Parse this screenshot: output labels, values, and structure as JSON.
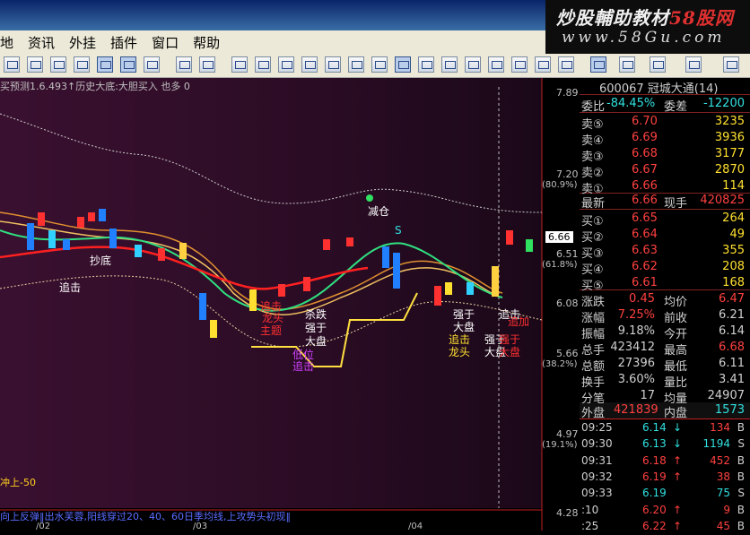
{
  "window": {
    "brand_line1": "炒股輔助教材",
    "brand_line1_red": "58股网",
    "brand_line2": "www.58Gu.com"
  },
  "menu": [
    "地",
    "资讯",
    "外挂",
    "插件",
    "窗口",
    "帮助"
  ],
  "chart": {
    "info_line": "买预测1.6.493↑历史大底:大胆买入 也多 0",
    "price_ticks": [
      "7.89",
      "7.20",
      "6.51",
      "6.08",
      "5.66",
      "4.97",
      "4.28"
    ],
    "pct_ticks": [
      "(80.9%)",
      "(61.8%)",
      "(38.2%)",
      "(19.1%)"
    ],
    "current_price_tag": "6.66",
    "bottom_text": "向上反弹‖出水芙蓉,阳线穿过20、40、60日季均线,上攻势头初现‖",
    "left_note": "冲上-50",
    "x_labels": [
      "/02",
      "/03",
      "/04"
    ],
    "annotations": [
      "追击",
      "减仓",
      "S",
      "追击",
      "龙头",
      "主题",
      "杀跌",
      "强于",
      "大盘",
      "低位",
      "追击",
      "抄底",
      "强于",
      "大盘",
      "追击",
      "龙头",
      "强于",
      "大盘",
      "追击",
      "追加",
      "强于",
      "大盘"
    ]
  },
  "quote": {
    "title": "600067 冠城大通(14)",
    "weibi_label": "委比",
    "weibi_value": "-84.45%",
    "weicha_label": "委差",
    "weicha_value": "-12200",
    "sells": [
      {
        "label": "卖⑤",
        "price": "6.70",
        "vol": "3235"
      },
      {
        "label": "卖④",
        "price": "6.69",
        "vol": "3936"
      },
      {
        "label": "卖③",
        "price": "6.68",
        "vol": "3177"
      },
      {
        "label": "卖②",
        "price": "6.67",
        "vol": "2870"
      },
      {
        "label": "卖①",
        "price": "6.66",
        "vol": "114"
      }
    ],
    "latest_label": "最新",
    "latest": "6.66",
    "nowhand_label": "现手",
    "nowhand": "420825",
    "buys": [
      {
        "label": "买①",
        "price": "6.65",
        "vol": "264"
      },
      {
        "label": "买②",
        "price": "6.64",
        "vol": "49"
      },
      {
        "label": "买③",
        "price": "6.63",
        "vol": "355"
      },
      {
        "label": "买④",
        "price": "6.62",
        "vol": "208"
      },
      {
        "label": "买⑤",
        "price": "6.61",
        "vol": "168"
      }
    ],
    "stats": [
      {
        "l1": "涨跌",
        "v1": "0.45",
        "l2": "均价",
        "v2": "6.47"
      },
      {
        "l1": "涨幅",
        "v1": "7.25%",
        "l2": "前收",
        "v2": "6.21"
      },
      {
        "l1": "振幅",
        "v1": "9.18%",
        "l2": "今开",
        "v2": "6.14"
      },
      {
        "l1": "总手",
        "v1": "423412",
        "l2": "最高",
        "v2": "6.68"
      },
      {
        "l1": "总额",
        "v1": "27396",
        "l2": "最低",
        "v2": "6.11"
      },
      {
        "l1": "换手",
        "v1": "3.60%",
        "l2": "量比",
        "v2": "3.41"
      },
      {
        "l1": "分笔",
        "v1": "17",
        "l2": "均量",
        "v2": "24907"
      }
    ],
    "outer_label": "外盘",
    "outer": "421839",
    "inner_label": "内盘",
    "inner": "1573",
    "trades": [
      {
        "time": "09:25",
        "price": "6.14",
        "arrow": "↓",
        "vol": "134",
        "side": "B"
      },
      {
        "time": "09:30",
        "price": "6.13",
        "arrow": "↓",
        "vol": "1194",
        "side": "S"
      },
      {
        "time": "09:31",
        "price": "6.18",
        "arrow": "↑",
        "vol": "452",
        "side": "B"
      },
      {
        "time": "09:32",
        "price": "6.19",
        "arrow": "↑",
        "vol": "38",
        "side": "B"
      },
      {
        "time": "09:33",
        "price": "6.19",
        "arrow": "",
        "vol": "75",
        "side": "S"
      },
      {
        "time": ":10",
        "price": "6.20",
        "arrow": "↑",
        "vol": "9",
        "side": "B"
      },
      {
        "time": ":25",
        "price": "6.22",
        "arrow": "↑",
        "vol": "45",
        "side": "B"
      }
    ]
  }
}
